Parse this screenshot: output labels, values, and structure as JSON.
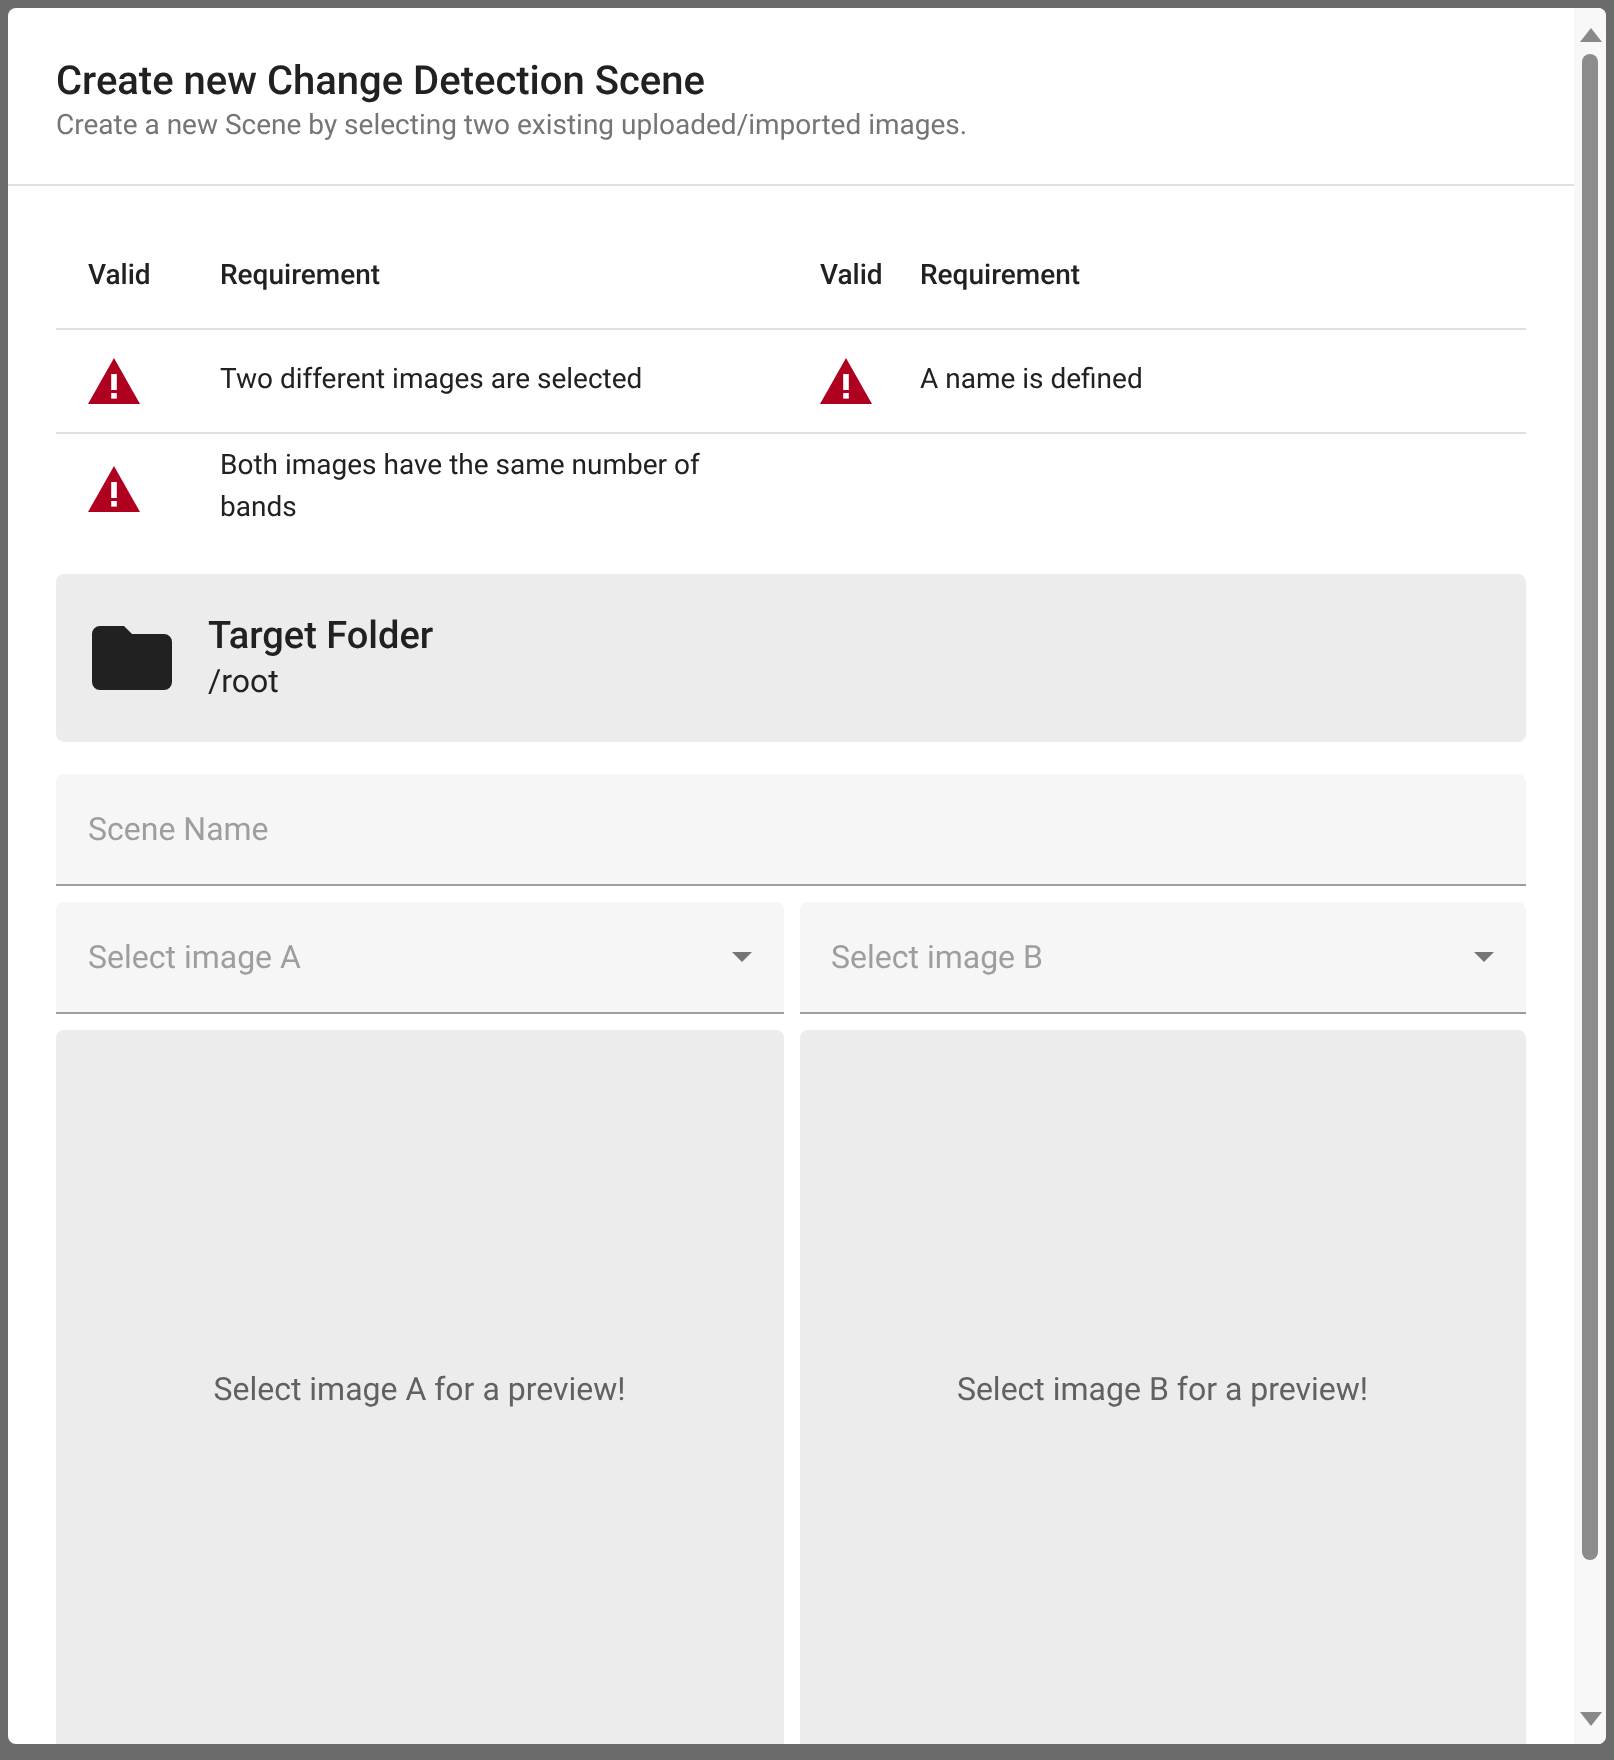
{
  "dialog": {
    "title": "Create new Change Detection Scene",
    "subtitle": "Create a new Scene by selecting two existing uploaded/imported images."
  },
  "requirements_table": {
    "columns": [
      "Valid",
      "Requirement",
      "Valid",
      "Requirement"
    ],
    "items": [
      {
        "valid": false,
        "text": "Two different images are selected"
      },
      {
        "valid": false,
        "text": "A name is defined"
      },
      {
        "valid": false,
        "text": "Both images have the same number of bands"
      }
    ]
  },
  "target_folder": {
    "title": "Target Folder",
    "path": "/root"
  },
  "scene_name": {
    "placeholder": "Scene Name"
  },
  "image_selects": [
    {
      "placeholder": "Select image A",
      "preview": "Select image A for a preview!"
    },
    {
      "placeholder": "Select image B",
      "preview": "Select image B for a preview!"
    }
  ]
}
